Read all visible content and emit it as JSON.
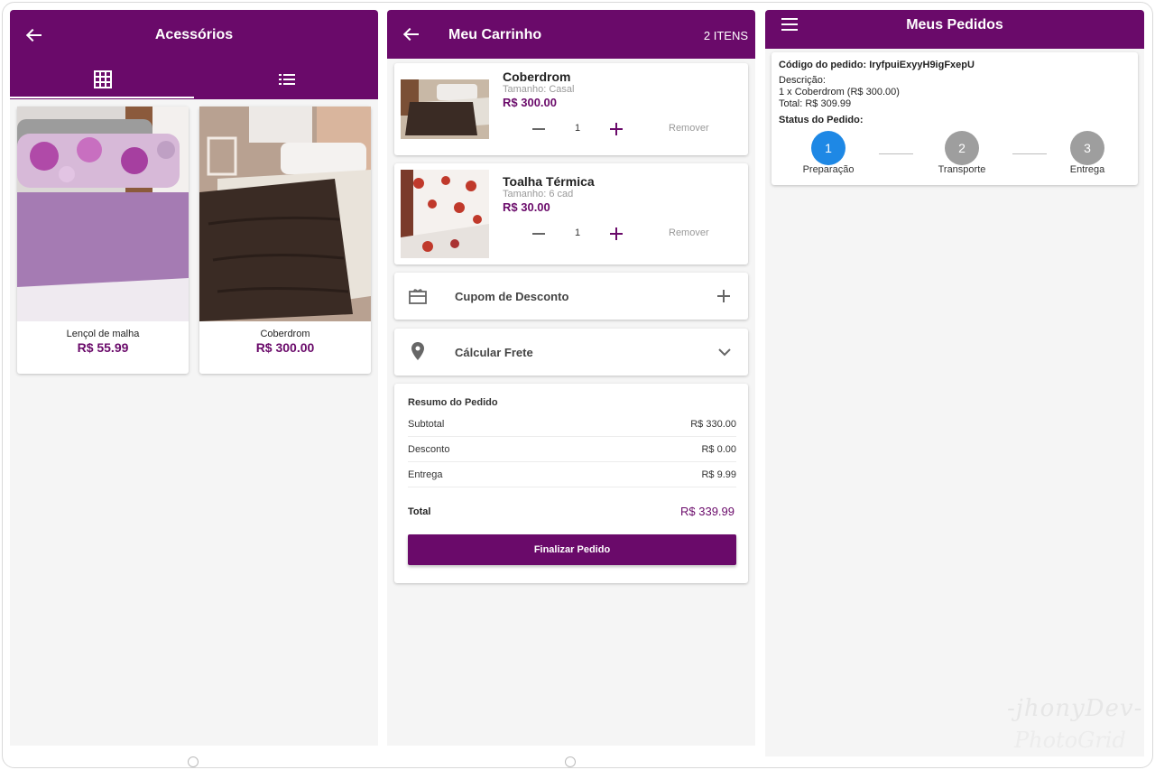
{
  "colors": {
    "brand": "#6a0a6a",
    "step_active": "#1e88e5",
    "step_inactive": "#9e9e9e",
    "background": "#f5f5f5"
  },
  "accessories": {
    "title": "Acessórios",
    "tabs": [
      "grid-icon",
      "list-icon"
    ],
    "products": [
      {
        "name": "Lençol de malha",
        "price": "R$ 55.99"
      },
      {
        "name": "Coberdrom",
        "price": "R$ 300.00"
      }
    ]
  },
  "cart": {
    "title": "Meu Carrinho",
    "count": "2 ITENS",
    "items": [
      {
        "name": "Coberdrom",
        "size": "Tamanho: Casal",
        "price": "R$ 300.00",
        "qty": "1",
        "remove": "Remover"
      },
      {
        "name": "Toalha Térmica",
        "size": "Tamanho: 6 cad",
        "price": "R$ 30.00",
        "qty": "1",
        "remove": "Remover"
      }
    ],
    "coupon_label": "Cupom de Desconto",
    "shipping_label": "Cálcular Frete",
    "summary": {
      "title": "Resumo do Pedido",
      "rows": [
        {
          "label": "Subtotal",
          "value": "R$ 330.00"
        },
        {
          "label": "Desconto",
          "value": "R$ 0.00"
        },
        {
          "label": "Entrega",
          "value": "R$ 9.99"
        }
      ],
      "total_label": "Total",
      "total_value": "R$ 339.99",
      "button": "Finalizar Pedido"
    }
  },
  "orders": {
    "title": "Meus Pedidos",
    "code_line": "Código do pedido: IryfpuiExyyH9igFxepU",
    "description_label": "Descrição:",
    "description": "1 x Coberdrom (R$ 300.00)",
    "total": "Total: R$ 309.99",
    "status_label": "Status do Pedido:",
    "steps": [
      {
        "number": "1",
        "label": "Preparação",
        "active": true
      },
      {
        "number": "2",
        "label": "Transporte",
        "active": false
      },
      {
        "number": "3",
        "label": "Entrega",
        "active": false
      }
    ]
  },
  "watermark": {
    "line1": "-jhonyDev-",
    "line2": "PhotoGrid"
  }
}
